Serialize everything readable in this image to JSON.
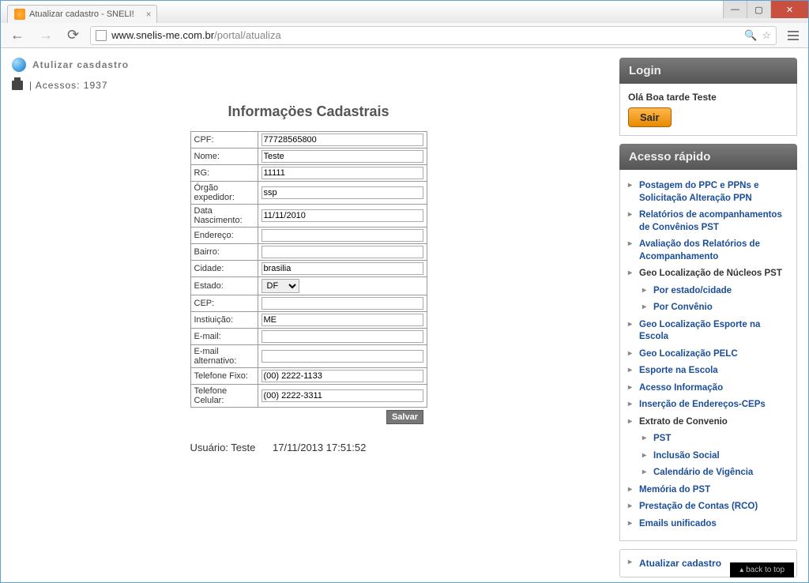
{
  "window": {
    "tab_title": "Atualizar cadastro - SNELI!",
    "url_host": "www.snelis-me.com.br",
    "url_path": "/portal/atualiza"
  },
  "header": {
    "title": "Atulizar casdastro",
    "acessos_label": "| Acessos: 1937"
  },
  "form": {
    "title": "Informaçöes Cadastrais",
    "fields": {
      "cpf": {
        "label": "CPF:",
        "value": "77728565800"
      },
      "nome": {
        "label": "Nome:",
        "value": "Teste"
      },
      "rg": {
        "label": "RG:",
        "value": "11111"
      },
      "orgao": {
        "label": "Órgão expedidor:",
        "value": "ssp"
      },
      "nasc": {
        "label": "Data Nascimento:",
        "value": "11/11/2010"
      },
      "endereco": {
        "label": "Endereço:",
        "value": ""
      },
      "bairro": {
        "label": "Bairro:",
        "value": ""
      },
      "cidade": {
        "label": "Cidade:",
        "value": "brasilia"
      },
      "estado": {
        "label": "Estado:",
        "value": "DF"
      },
      "cep": {
        "label": "CEP:",
        "value": ""
      },
      "inst": {
        "label": "Instiuição:",
        "value": "ME"
      },
      "email": {
        "label": "E-mail:",
        "value": ""
      },
      "email2": {
        "label": "E-mail alternativo:",
        "value": ""
      },
      "telfixo": {
        "label": "Telefone Fixo:",
        "value": "(00) 2222-1133"
      },
      "telcel": {
        "label": "Telefone Celular:",
        "value": "(00) 2222-3311"
      }
    },
    "save_label": "Salvar",
    "usuario": "Usuário: Teste",
    "timestamp": "17/11/2013 17:51:52"
  },
  "login": {
    "title": "Login",
    "greeting": "Olá Boa tarde Teste",
    "logout": "Sair"
  },
  "quick": {
    "title": "Acesso rápido",
    "items": [
      {
        "label": "Postagem do PPC e PPNs e Solicitação Alteração PPN"
      },
      {
        "label": "Relatórios de acompanhamentos de Convênios PST"
      },
      {
        "label": "Avaliação dos Relatórios de Acompanhamento"
      },
      {
        "label": "Geo Localização de Núcleos PST",
        "current": true
      },
      {
        "label": "Por estado/cidade",
        "sub": true
      },
      {
        "label": "Por Convênio",
        "sub": true
      },
      {
        "label": "Geo Localização Esporte na Escola"
      },
      {
        "label": "Geo Localização PELC"
      },
      {
        "label": "Esporte na Escola"
      },
      {
        "label": "Acesso Informação"
      },
      {
        "label": "Inserção de Endereços-CEPs"
      },
      {
        "label": "Extrato de Convenio",
        "current": true
      },
      {
        "label": "PST",
        "sub": true
      },
      {
        "label": "Inclusão Social",
        "sub": true
      },
      {
        "label": "Calendário de Vigência",
        "sub": true
      },
      {
        "label": "Memória do PST"
      },
      {
        "label": "Prestação de Contas (RCO)"
      },
      {
        "label": "Emails unificados"
      }
    ],
    "atualizar": "Atualizar cadastro"
  },
  "backtop": "back to top"
}
